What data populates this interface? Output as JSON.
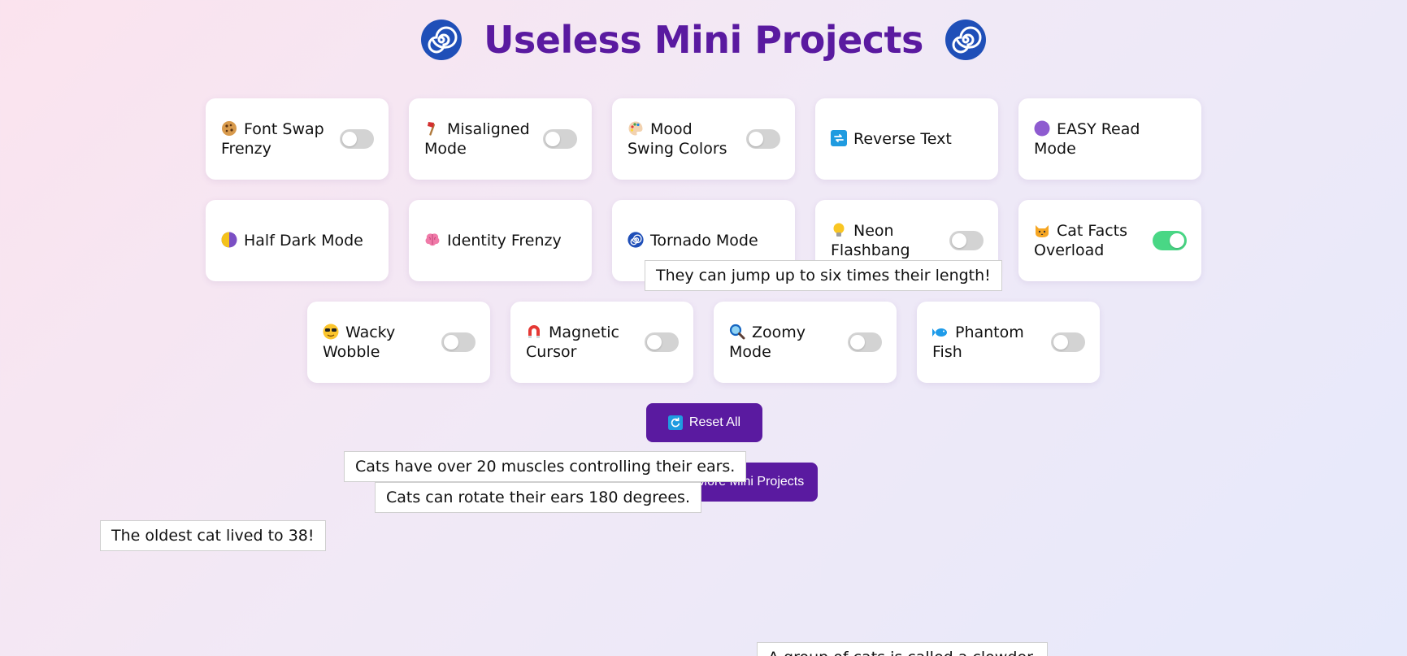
{
  "header": {
    "title": "Useless Mini Projects",
    "icon": "cyclone-icon"
  },
  "cards_row1": [
    {
      "label": "Font Swap Frenzy",
      "icon": "cookie-icon",
      "toggle": false
    },
    {
      "label": "Misaligned Mode",
      "icon": "axe-icon",
      "toggle": false
    },
    {
      "label": "Mood Swing Colors",
      "icon": "palette-icon",
      "toggle": false
    },
    {
      "label": "Reverse Text",
      "icon": "repeat-icon"
    },
    {
      "label": "EASY Read Mode",
      "icon": "purple-circle-icon"
    }
  ],
  "cards_row2": [
    {
      "label": "Half Dark Mode",
      "icon": "half-moon-icon"
    },
    {
      "label": "Identity Frenzy",
      "icon": "brain-icon"
    },
    {
      "label": "Tornado Mode",
      "icon": "cyclone-icon"
    },
    {
      "label": "Neon Flashbang",
      "icon": "lightbulb-icon",
      "toggle": false
    },
    {
      "label": "Cat Facts Overload",
      "icon": "cat-icon",
      "toggle": true
    }
  ],
  "cards_row3": [
    {
      "label": "Wacky Wobble",
      "icon": "sunglasses-face-icon",
      "toggle": false
    },
    {
      "label": "Magnetic Cursor",
      "icon": "magnet-icon",
      "toggle": false
    },
    {
      "label": "Zoomy Mode",
      "icon": "magnifier-icon",
      "toggle": false
    },
    {
      "label": "Phantom Fish",
      "icon": "fish-icon",
      "toggle": false
    }
  ],
  "buttons": {
    "reset": "Reset All",
    "more": "More Mini Projects"
  },
  "cat_facts": [
    "They can jump up to six times their length!",
    "Cats have over 20 muscles controlling their ears.",
    "Cats can rotate their ears 180 degrees.",
    "The oldest cat lived to 38!",
    "A group of cats is called a clowder."
  ],
  "colors": {
    "accent": "#5a1aa0",
    "toggle_on": "#49d785",
    "toggle_off": "#d3d3d3"
  }
}
